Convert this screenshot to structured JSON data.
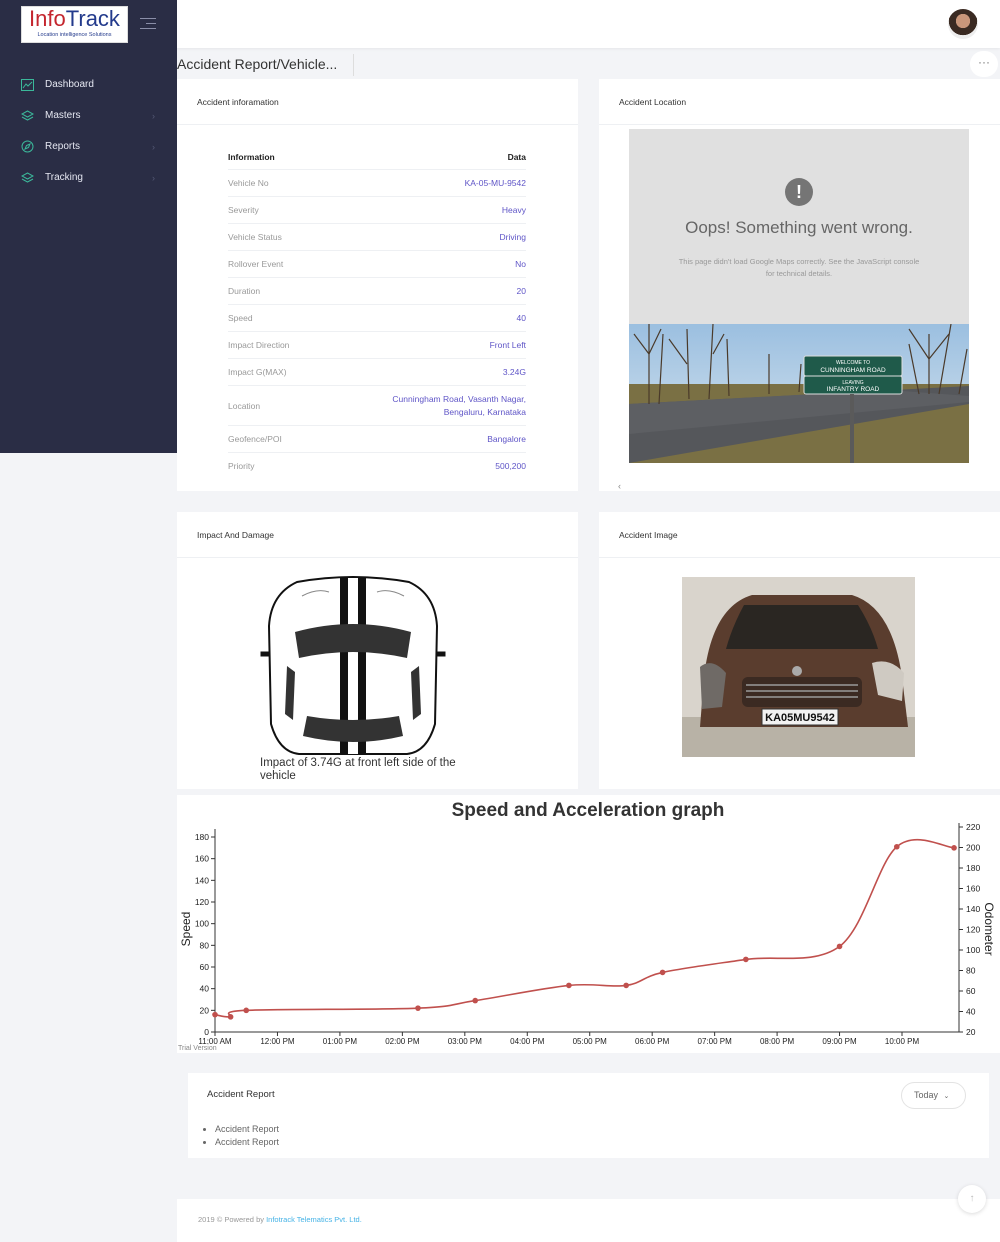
{
  "brand": {
    "name_part1": "Info",
    "name_part2": "Track",
    "tagline": "Location intelligence Solutions"
  },
  "sidebar": {
    "items": [
      {
        "label": "Dashboard",
        "icon": "chart-icon",
        "has_arrow": false
      },
      {
        "label": "Masters",
        "icon": "layers-icon",
        "has_arrow": true
      },
      {
        "label": "Reports",
        "icon": "compass-icon",
        "has_arrow": true
      },
      {
        "label": "Tracking",
        "icon": "layers-icon",
        "has_arrow": true
      }
    ]
  },
  "header": {
    "page_title": "Accident Report/Vehicle...",
    "more_label": "···"
  },
  "info_card": {
    "title": "Accident inforamation",
    "col_info": "Information",
    "col_data": "Data",
    "rows": [
      {
        "key": "Vehicle No",
        "value": "KA-05-MU-9542"
      },
      {
        "key": "Severity",
        "value": "Heavy"
      },
      {
        "key": "Vehicle Status",
        "value": "Driving"
      },
      {
        "key": "Rollover Event",
        "value": "No"
      },
      {
        "key": "Duration",
        "value": "20"
      },
      {
        "key": "Speed",
        "value": "40"
      },
      {
        "key": "Impact Direction",
        "value": "Front Left"
      },
      {
        "key": "Impact G(MAX)",
        "value": "3.24G"
      },
      {
        "key": "Location",
        "value": "Cunningham Road, Vasanth Nagar, Bengaluru, Karnataka"
      },
      {
        "key": "Geofence/POI",
        "value": "Bangalore"
      },
      {
        "key": "Priority",
        "value": "500,200"
      }
    ]
  },
  "location_card": {
    "title": "Accident Location",
    "error_title": "Oops! Something went wrong.",
    "error_message_1": "This page didn't load Google Maps correctly. See the JavaScript console",
    "error_message_2": "for technical details.",
    "sign_line1": "WELCOME TO",
    "sign_line2": "CUNNINGHAM ROAD",
    "sign_line3": "LEAVING",
    "sign_line4": "INFANTRY ROAD",
    "nav_arrow": "‹"
  },
  "impact_card": {
    "title": "Impact And Damage",
    "caption": "Impact of 3.74G at front left side of the vehicle"
  },
  "image_card": {
    "title": "Accident Image",
    "plate": "KA05MU9542"
  },
  "chart_data": {
    "type": "line",
    "title": "Speed and Acceleration graph",
    "ylabel": "Speed",
    "y2label": "Odometer",
    "watermark": "Trial Version",
    "xlim": [
      "11:00 AM",
      "10:00 PM"
    ],
    "x_ticks": [
      "11:00 AM",
      "12:00 PM",
      "01:00 PM",
      "02:00 PM",
      "03:00 PM",
      "04:00 PM",
      "05:00 PM",
      "06:00 PM",
      "07:00 PM",
      "08:00 PM",
      "09:00 PM",
      "10:00 PM"
    ],
    "ylim": [
      0,
      180
    ],
    "y_ticks": [
      0,
      20,
      40,
      60,
      80,
      100,
      120,
      140,
      160,
      180
    ],
    "y2lim": [
      20,
      220
    ],
    "y2_ticks": [
      20,
      40,
      60,
      80,
      100,
      120,
      140,
      160,
      180,
      200,
      220
    ],
    "color": "#c0504d",
    "series": [
      {
        "x": [
          "11:00 AM",
          "11:15 AM",
          "11:30 AM",
          "02:15 PM",
          "03:10 PM",
          "04:40 PM",
          "05:35 PM",
          "06:10 PM",
          "07:30 PM",
          "09:00 PM",
          "09:55 PM",
          "10:50 PM"
        ],
        "values": [
          16,
          14,
          20,
          22,
          29,
          43,
          43,
          55,
          67,
          79,
          171,
          170
        ]
      }
    ]
  },
  "report_card": {
    "title": "Accident Report",
    "filter_label": "Today",
    "items": [
      "Accident Report",
      "Accident Report"
    ]
  },
  "footer": {
    "text": "2019 © Powered by",
    "link": "Infotrack Telematics Pvt. Ltd.",
    "top_icon": "↑"
  }
}
